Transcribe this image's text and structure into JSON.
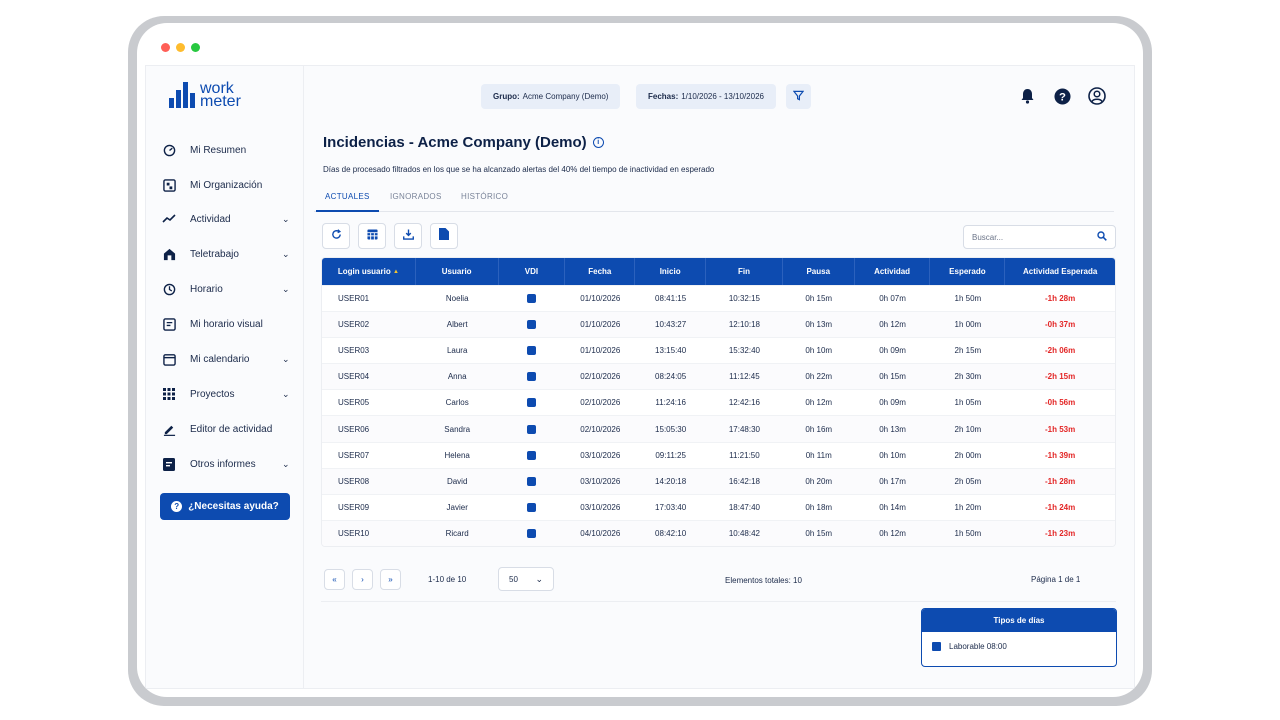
{
  "colors": {
    "brand": "#0d4bb0",
    "negative": "#e32626",
    "dot_red": "#ff5f57",
    "dot_yellow": "#febc2e",
    "dot_green": "#28c840"
  },
  "logo": {
    "line1": "work",
    "line2": "meter"
  },
  "sidebar": {
    "items": [
      {
        "label": "Mi Resumen",
        "icon": "gauge-icon",
        "chevron": false
      },
      {
        "label": "Mi Organización",
        "icon": "org-chart-icon",
        "chevron": false
      },
      {
        "label": "Actividad",
        "icon": "trend-line-icon",
        "chevron": true
      },
      {
        "label": "Teletrabajo",
        "icon": "house-icon",
        "chevron": true
      },
      {
        "label": "Horario",
        "icon": "clock-icon",
        "chevron": true
      },
      {
        "label": "Mi horario visual",
        "icon": "schedule-icon",
        "chevron": false
      },
      {
        "label": "Mi calendario",
        "icon": "calendar-icon",
        "chevron": true
      },
      {
        "label": "Proyectos",
        "icon": "grid-icon",
        "chevron": true
      },
      {
        "label": "Editor de actividad",
        "icon": "pencil-icon",
        "chevron": false
      },
      {
        "label": "Otros informes",
        "icon": "report-icon",
        "chevron": true
      }
    ],
    "help_label": "¿Necesitas ayuda?"
  },
  "header": {
    "group_label": "Grupo:",
    "group_value": "Acme Company (Demo)",
    "dates_label": "Fechas:",
    "dates_value": "1/10/2026 - 13/10/2026"
  },
  "page": {
    "title": "Incidencias - Acme Company (Demo)",
    "subtitle": "Días de procesado filtrados en los que se ha alcanzado alertas del 40% del tiempo de inactividad en esperado"
  },
  "tabs": [
    {
      "label": "ACTUALES",
      "active": true
    },
    {
      "label": "IGNORADOS",
      "active": false
    },
    {
      "label": "HISTÓRICO",
      "active": false
    }
  ],
  "search": {
    "placeholder": "Buscar..."
  },
  "table": {
    "columns": [
      "Login usuario",
      "Usuario",
      "VDI",
      "Fecha",
      "Inicio",
      "Fin",
      "Pausa",
      "Actividad",
      "Esperado",
      "Actividad Esperada"
    ],
    "sort_indicator": "▲",
    "rows": [
      [
        "USER01",
        "Noelia",
        "",
        "01/10/2026",
        "08:41:15",
        "10:32:15",
        "0h 15m",
        "0h 07m",
        "1h 50m",
        "-1h 28m"
      ],
      [
        "USER02",
        "Albert",
        "",
        "01/10/2026",
        "10:43:27",
        "12:10:18",
        "0h 13m",
        "0h 12m",
        "1h 00m",
        "-0h 37m"
      ],
      [
        "USER03",
        "Laura",
        "",
        "01/10/2026",
        "13:15:40",
        "15:32:40",
        "0h 10m",
        "0h 09m",
        "2h 15m",
        "-2h 06m"
      ],
      [
        "USER04",
        "Anna",
        "",
        "02/10/2026",
        "08:24:05",
        "11:12:45",
        "0h 22m",
        "0h 15m",
        "2h 30m",
        "-2h 15m"
      ],
      [
        "USER05",
        "Carlos",
        "",
        "02/10/2026",
        "11:24:16",
        "12:42:16",
        "0h 12m",
        "0h 09m",
        "1h 05m",
        "-0h 56m"
      ],
      [
        "USER06",
        "Sandra",
        "",
        "02/10/2026",
        "15:05:30",
        "17:48:30",
        "0h 16m",
        "0h 13m",
        "2h 10m",
        "-1h 53m"
      ],
      [
        "USER07",
        "Helena",
        "",
        "03/10/2026",
        "09:11:25",
        "11:21:50",
        "0h 11m",
        "0h 10m",
        "2h 00m",
        "-1h 39m"
      ],
      [
        "USER08",
        "David",
        "",
        "03/10/2026",
        "14:20:18",
        "16:42:18",
        "0h 20m",
        "0h 17m",
        "2h 05m",
        "-1h 28m"
      ],
      [
        "USER09",
        "Javier",
        "",
        "03/10/2026",
        "17:03:40",
        "18:47:40",
        "0h 18m",
        "0h 14m",
        "1h 20m",
        "-1h 24m"
      ],
      [
        "USER10",
        "Ricard",
        "",
        "04/10/2026",
        "08:42:10",
        "10:48:42",
        "0h 15m",
        "0h 12m",
        "1h 50m",
        "-1h 23m"
      ]
    ]
  },
  "pagination": {
    "first": "«",
    "prev": "›",
    "next": "»",
    "range": "1-10 de 10",
    "page_size": "50",
    "total_label": "Elementos totales:",
    "total_value": "10",
    "page_info": "Página 1 de 1"
  },
  "legend": {
    "title": "Tipos de días",
    "items": [
      {
        "label": "Laborable 08:00"
      }
    ]
  }
}
